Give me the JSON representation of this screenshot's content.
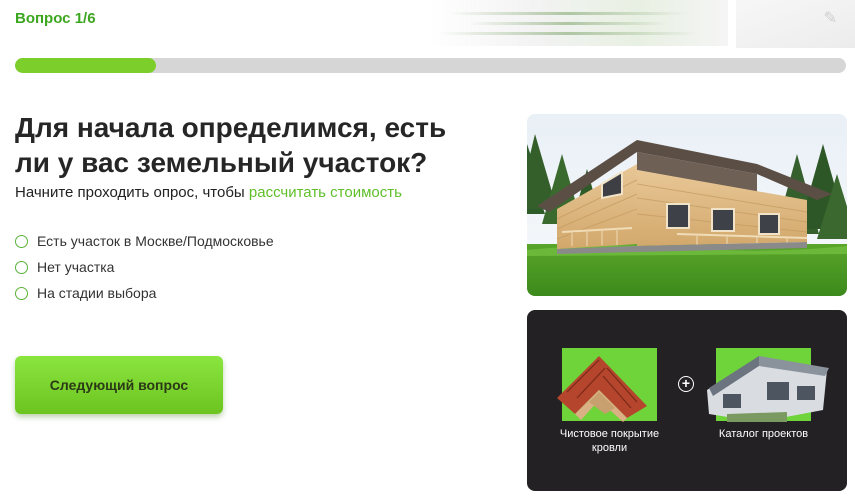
{
  "header": {
    "question_counter": "Вопрос 1/6",
    "progress_fraction": 0.17
  },
  "question": {
    "title": "Для начала определимся, есть ли у вас земельный участок?",
    "subtitle_text": "Начните проходить опрос, чтобы ",
    "subtitle_link": "рассчитать стоимость"
  },
  "options": [
    {
      "label": "Есть участок в Москве/Подмосковье"
    },
    {
      "label": "Нет участка"
    },
    {
      "label": "На стадии выбора"
    }
  ],
  "next_button_label": "Следующий вопрос",
  "promo": {
    "item1_caption": "Чистовое покрытие кровли",
    "item2_caption": "Каталог проектов",
    "plus_symbol": "+"
  },
  "colors": {
    "accent_green": "#3da620",
    "progress_fill": "#7ccf2a",
    "link_green": "#5fbf2a",
    "promo_background": "#242124",
    "tile_green": "#6fd33a"
  },
  "icons": {
    "promo_plus": "plus-circle-icon"
  }
}
